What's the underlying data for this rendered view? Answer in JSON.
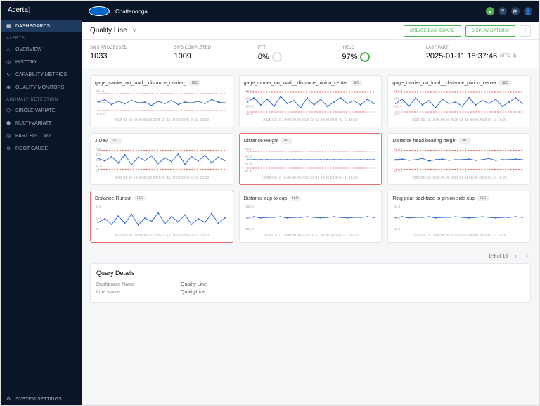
{
  "brand": "Acerta",
  "topbar": {
    "location": "Chattanooga"
  },
  "top_icons": {
    "help": "?",
    "grid": "⊞",
    "user": "👤"
  },
  "sidebar": {
    "dashboards": "DASHBOARDS",
    "sections": {
      "alerts": "ALERTS",
      "anomaly": "ANOMALY DETECTION"
    },
    "items": {
      "overview": "OVERVIEW",
      "history": "HISTORY",
      "capability": "CAPABILITY METRICS",
      "quality": "QUALITY MONITORS",
      "single": "SINGLE VARIATE",
      "multi": "MULTI-VARIATE",
      "parthistory": "PART HISTORY",
      "rootcause": "ROOT CAUSE",
      "settings": "SYSTEM SETTINGS"
    }
  },
  "subbar": {
    "title": "Quality Line",
    "create": "CREATE DASHBOARD",
    "display": "DISPLAY OPTIONS"
  },
  "kpis": {
    "processed": {
      "label": "SN'S PROCESSED",
      "value": "1033"
    },
    "completed": {
      "label": "SN'S COMPLETED",
      "value": "1009"
    },
    "ftt": {
      "label": "FTT",
      "value": "0%"
    },
    "yield": {
      "label": "YIELD",
      "value": "97%"
    },
    "last": {
      "label": "LAST PART",
      "value": "2025-01-11 18:37:46",
      "tz": "(UTC -5)"
    }
  },
  "cards": [
    {
      "title": "gage_carrier_no_load__distance_carrier_",
      "tag": "I&C",
      "yticks": [
        "171.1",
        "170.9",
        "170.8"
      ],
      "alert": false
    },
    {
      "title": "gage_carrier_no_load__distance_pinion_center",
      "tag": "I&C",
      "yticks": [
        "105.5",
        "105.1",
        "103.9",
        "103.7"
      ],
      "alert": false
    },
    {
      "title": "gage_carrier_no_load__distance_pinion_center",
      "tag": "I&C",
      "yticks": [
        "105.5",
        "105.1",
        "103.9",
        "103.7"
      ],
      "alert": false
    },
    {
      "title": "J Dev",
      "tag": "I&C",
      "yticks": [
        "0.4",
        "0.3",
        "0.2",
        "0.1",
        "0"
      ],
      "alert": false
    },
    {
      "title": "Distance Height",
      "tag": "I&C",
      "yticks": [
        "92.2",
        "92.0",
        "91.8",
        "91.6"
      ],
      "alert": true
    },
    {
      "title": "Distance head bearing height",
      "tag": "I&C",
      "yticks": [
        "36.4",
        "36.2",
        "36.0"
      ],
      "alert": false
    },
    {
      "title": "Distance-Runout",
      "tag": "I&C",
      "yticks": [
        "0.4",
        "0.2",
        "0"
      ],
      "alert": true
    },
    {
      "title": "Distance cup to cup",
      "tag": "I&C",
      "yticks": [
        "105.8",
        "105.6",
        "105.4"
      ],
      "alert": false
    },
    {
      "title": "Ring gear backface to pinion side cup",
      "tag": "I&C",
      "yticks": [
        "52.8",
        "52.6",
        "52.4"
      ],
      "alert": false
    }
  ],
  "chart_data": [
    {
      "type": "line",
      "title": "gage_carrier_no_load__distance_carrier_",
      "ylim": [
        170.8,
        171.1
      ],
      "values": [
        170.95,
        170.98,
        170.92,
        170.96,
        170.93,
        170.97,
        170.94,
        170.95,
        170.91,
        170.96,
        170.93,
        170.97,
        170.92,
        170.95,
        170.94,
        170.96,
        170.93,
        170.98,
        170.95,
        170.94
      ],
      "limits": [
        170.85,
        171.05
      ]
    },
    {
      "type": "line",
      "title": "gage_carrier_no_load__distance_pinion_center",
      "ylim": [
        103.7,
        105.5
      ],
      "values": [
        104.6,
        104.9,
        104.4,
        104.8,
        104.3,
        105.0,
        104.5,
        104.7,
        104.2,
        104.9,
        104.4,
        104.8,
        104.3,
        104.6,
        104.9,
        104.5,
        104.7,
        104.4,
        104.8,
        104.5
      ],
      "limits": [
        103.9,
        105.3
      ]
    },
    {
      "type": "line",
      "title": "gage_carrier_no_load__distance_pinion_center",
      "ylim": [
        103.7,
        105.5
      ],
      "values": [
        104.5,
        104.8,
        104.3,
        104.9,
        104.4,
        104.7,
        104.2,
        104.8,
        104.5,
        104.6,
        104.3,
        104.9,
        104.4,
        104.7,
        104.5,
        104.8,
        104.3,
        104.6,
        104.9,
        104.5
      ],
      "limits": [
        103.9,
        105.3
      ]
    },
    {
      "type": "line",
      "title": "J Dev",
      "ylim": [
        0,
        0.4
      ],
      "values": [
        0.22,
        0.18,
        0.25,
        0.15,
        0.28,
        0.12,
        0.24,
        0.19,
        0.26,
        0.14,
        0.23,
        0.17,
        0.29,
        0.13,
        0.25,
        0.18,
        0.27,
        0.15,
        0.24,
        0.19
      ],
      "limits": [
        0.05,
        0.35
      ]
    },
    {
      "type": "line",
      "title": "Distance Height",
      "ylim": [
        91.6,
        92.2
      ],
      "values": [
        91.9,
        91.9,
        91.9,
        91.9,
        91.9,
        91.9,
        91.9,
        91.9,
        91.9,
        91.9,
        91.9,
        91.9,
        91.9,
        91.9,
        91.9,
        91.9,
        91.9,
        91.9,
        91.9,
        91.9
      ],
      "limits": [
        91.7,
        92.1
      ]
    },
    {
      "type": "line",
      "title": "Distance head bearing height",
      "ylim": [
        36.0,
        36.4
      ],
      "values": [
        36.2,
        36.21,
        36.19,
        36.2,
        36.22,
        36.18,
        36.2,
        36.21,
        36.19,
        36.2,
        36.2,
        36.21,
        36.19,
        36.2,
        36.22,
        36.19,
        36.2,
        36.2,
        36.21,
        36.2
      ],
      "limits": [
        36.05,
        36.35
      ]
    },
    {
      "type": "line",
      "title": "Distance-Runout",
      "ylim": [
        0,
        0.4
      ],
      "values": [
        0.12,
        0.18,
        0.09,
        0.22,
        0.11,
        0.25,
        0.08,
        0.19,
        0.14,
        0.27,
        0.1,
        0.21,
        0.13,
        0.24,
        0.09,
        0.18,
        0.12,
        0.26,
        0.11,
        0.19
      ],
      "limits": [
        0.05,
        0.35
      ]
    },
    {
      "type": "line",
      "title": "Distance cup to cup",
      "ylim": [
        105.4,
        105.8
      ],
      "values": [
        105.6,
        105.61,
        105.59,
        105.6,
        105.6,
        105.61,
        105.59,
        105.6,
        105.6,
        105.61,
        105.6,
        105.59,
        105.6,
        105.61,
        105.6,
        105.59,
        105.6,
        105.6,
        105.61,
        105.6
      ],
      "limits": [
        105.45,
        105.75
      ]
    },
    {
      "type": "line",
      "title": "Ring gear backface to pinion side cup",
      "ylim": [
        52.4,
        52.8
      ],
      "values": [
        52.6,
        52.61,
        52.59,
        52.6,
        52.6,
        52.61,
        52.59,
        52.6,
        52.6,
        52.61,
        52.6,
        52.59,
        52.6,
        52.61,
        52.6,
        52.59,
        52.6,
        52.6,
        52.61,
        52.6
      ],
      "limits": [
        52.45,
        52.75
      ]
    }
  ],
  "xaxis": "2025-01-10 19:00:00:00   2025-01-11 08:00   2025-01-11 18:00",
  "pager": {
    "text": "1-9 of 10",
    "prev": "‹",
    "next": "›"
  },
  "details": {
    "title": "Query Details",
    "rows": [
      {
        "key": "Dashboard Name",
        "value": "Quality Line"
      },
      {
        "key": "Line Name",
        "value": "QualityLine"
      }
    ]
  }
}
